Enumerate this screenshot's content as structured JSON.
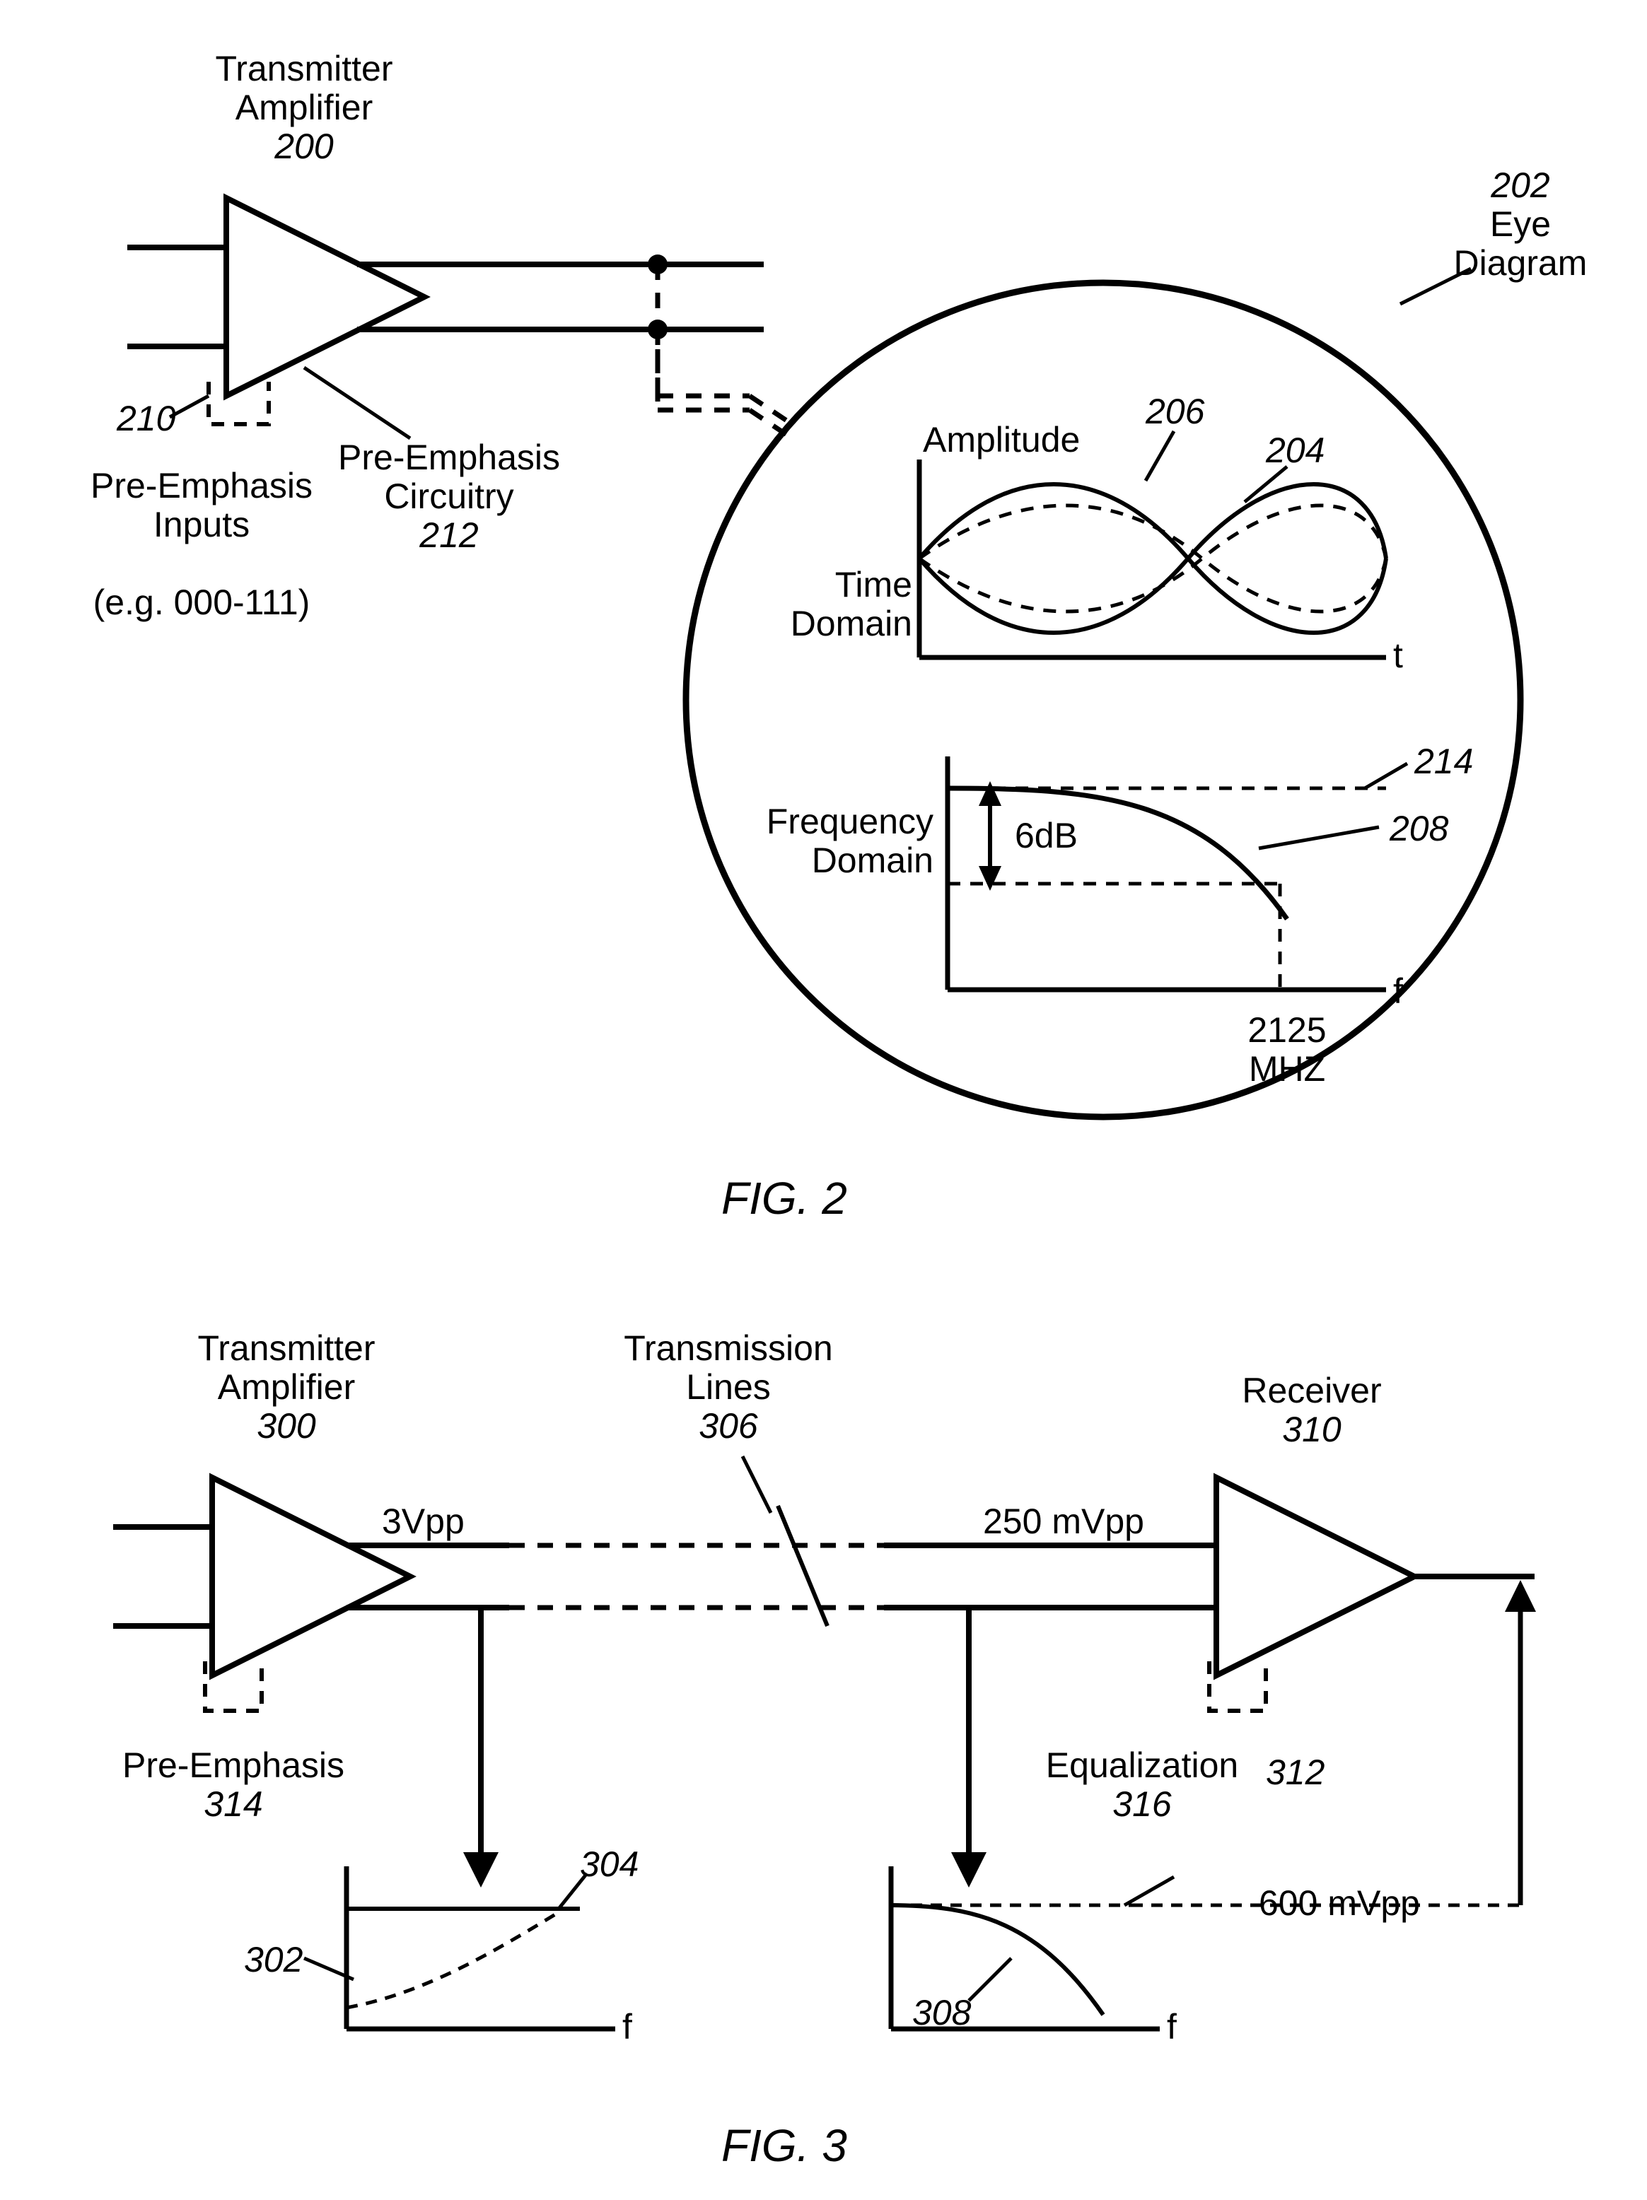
{
  "fig2": {
    "tx_label_l1": "Transmitter",
    "tx_label_l2": "Amplifier",
    "tx_ref": "200",
    "preemp_inputs_l1": "Pre-Emphasis",
    "preemp_inputs_l2": "Inputs",
    "preemp_inputs_l3": "(e.g. 000-111)",
    "preemp_ref": "210",
    "preemp_circ_l1": "Pre-Emphasis",
    "preemp_circ_l2": "Circuitry",
    "preemp_circ_ref": "212",
    "eye_l1": "Eye",
    "eye_l2": "Diagram",
    "eye_ref": "202",
    "amplitude": "Amplitude",
    "time_l1": "Time",
    "time_l2": "Domain",
    "t_axis": "t",
    "time_ref1": "206",
    "time_ref2": "204",
    "freq_l1": "Frequency",
    "freq_l2": "Domain",
    "f_axis": "f",
    "six_db": "6dB",
    "freq_val_l1": "2125",
    "freq_val_l2": "MHZ",
    "freq_ref1": "214",
    "freq_ref2": "208",
    "caption": "FIG. 2"
  },
  "fig3": {
    "tx_label_l1": "Transmitter",
    "tx_label_l2": "Amplifier",
    "tx_ref": "300",
    "tl_l1": "Transmission",
    "tl_l2": "Lines",
    "tl_ref": "306",
    "rx_l1": "Receiver",
    "rx_ref": "310",
    "vpp_tx": "3Vpp",
    "vpp_mid": "250 mVpp",
    "preemp_l1": "Pre-Emphasis",
    "preemp_ref": "314",
    "eq_l1": "Equalization",
    "eq_ref": "316",
    "left_plot_ref1": "302",
    "left_plot_ref2": "304",
    "right_plot_ref1": "308",
    "right_plot_ref2": "312",
    "out_vpp": "600 mVpp",
    "f_axis": "f",
    "caption": "FIG. 3"
  }
}
